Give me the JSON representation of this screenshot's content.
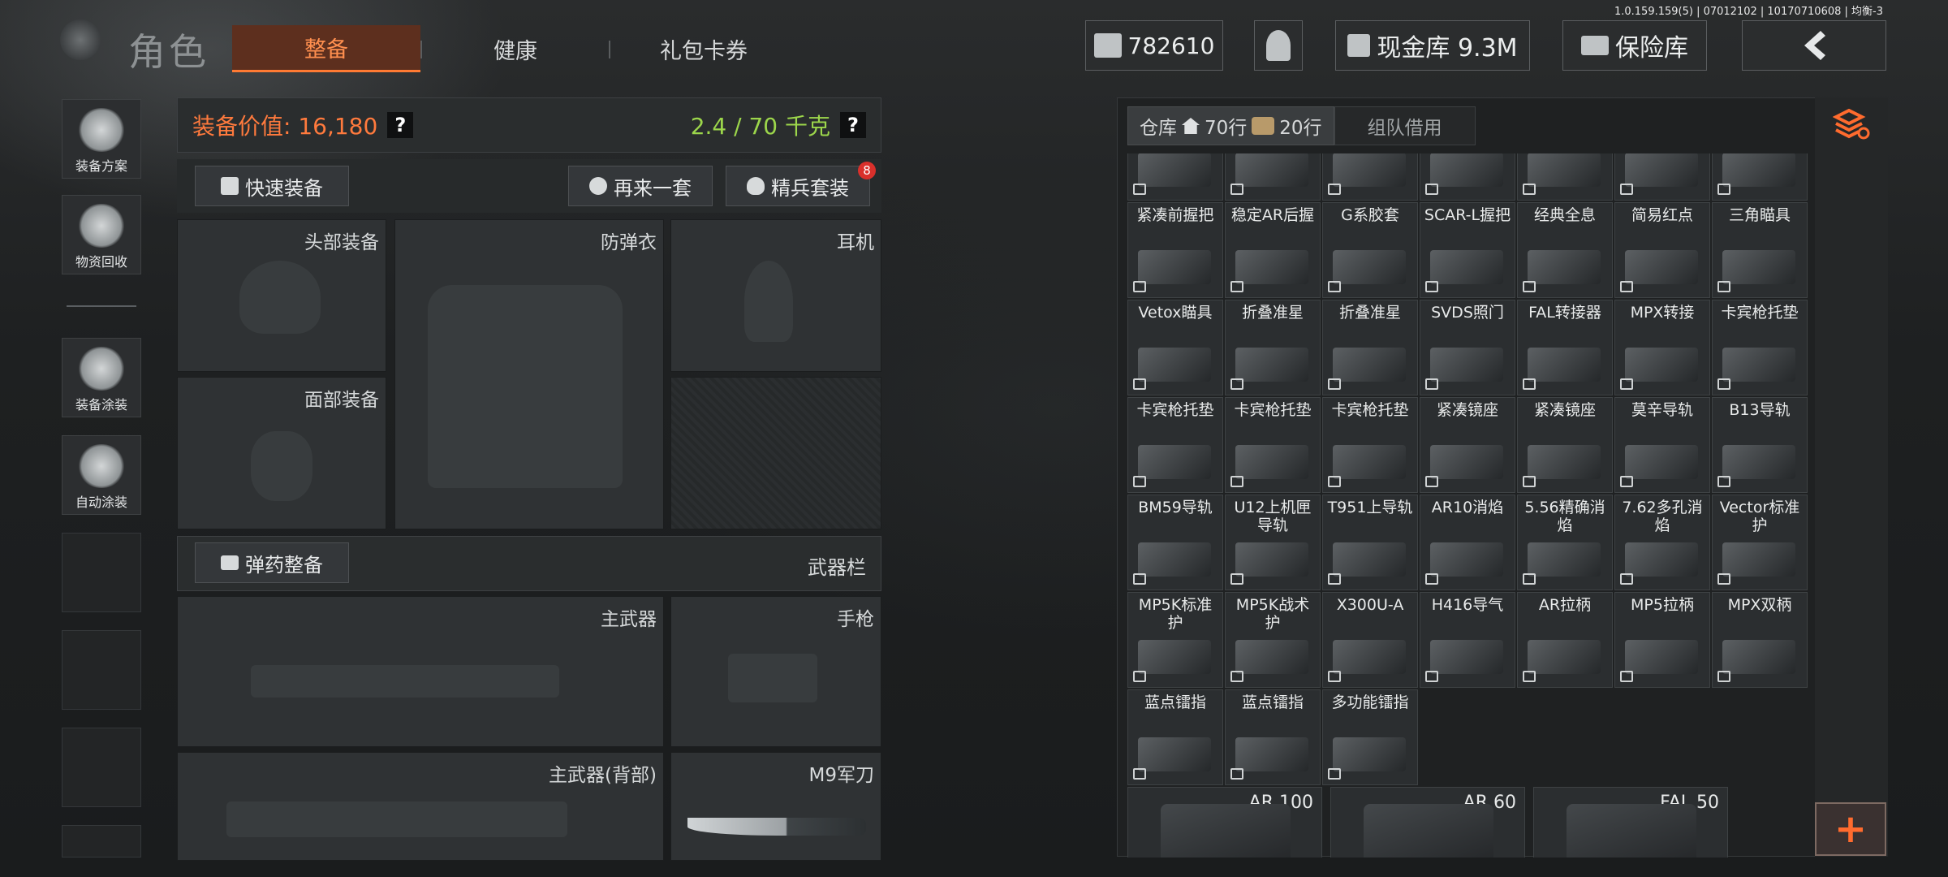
{
  "version": "1.0.159.159(5) | 07012102 | 10170710608 | 均衡-3",
  "header": {
    "title": "角色",
    "tabs": [
      {
        "label": "整备",
        "active": true
      },
      {
        "label": "健康",
        "active": false
      },
      {
        "label": "礼包卡券",
        "active": false
      }
    ],
    "currency": "782610",
    "cash_label": "现金库 9.3M",
    "insurance_label": "保险库"
  },
  "sidebar": [
    {
      "label": "装备方案",
      "icon": "helmet-loadout-icon"
    },
    {
      "label": "物资回收",
      "icon": "recycle-icon"
    },
    {
      "label": "装备涂装",
      "icon": "skin-icon"
    },
    {
      "label": "自动涂装",
      "icon": "auto-paint-icon"
    }
  ],
  "loadout": {
    "value_label": "装备价值: 16,180",
    "weight_label": "2.4 / 70 千克",
    "help": "?",
    "quick_equip": "快速装备",
    "again": "再来一套",
    "elite": "精兵套装",
    "elite_badge": "8",
    "slots": {
      "head": "头部装备",
      "armor": "防弹衣",
      "headset": "耳机",
      "face": "面部装备"
    },
    "ammo_button": "弹药整备",
    "weapon_bar": "武器栏",
    "primary": "主武器",
    "pistol": "手枪",
    "primary_back": "主武器(背部)",
    "knife": "M9军刀"
  },
  "stash": {
    "tab_label": "仓库",
    "rows_a": "70行",
    "rows_b": "20行",
    "team_tab": "组队借用",
    "row0": [
      "",
      "",
      "",
      "",
      "",
      "",
      ""
    ],
    "items": [
      [
        "紧凑前握把",
        "稳定AR后握",
        "G系胶套",
        "SCAR-L握把",
        "经典全息",
        "简易红点",
        "三角瞄具"
      ],
      [
        "Vetox瞄具",
        "折叠准星",
        "折叠准星",
        "SVDS照门",
        "FAL转接器",
        "MPX转接",
        "卡宾枪托垫"
      ],
      [
        "卡宾枪托垫",
        "卡宾枪托垫",
        "卡宾枪托垫",
        "紧凑镜座",
        "紧凑镜座",
        "莫辛导轨",
        "B13导轨"
      ],
      [
        "BM59导轨",
        "U12上机匣导轨",
        "T951上导轨",
        "AR10消焰",
        "5.56精确消焰",
        "7.62多孔消焰",
        "Vector标准护"
      ],
      [
        "MP5K标准护",
        "MP5K战术护",
        "X300U-A",
        "H416导气",
        "AR拉柄",
        "MP5拉柄",
        "MPX双柄"
      ],
      [
        "蓝点镭指",
        "蓝点镭指",
        "多功能镭指"
      ]
    ],
    "mags": [
      "AR 100",
      "AR 60",
      "FAL 50"
    ],
    "add": "+"
  },
  "colors": {
    "accent": "#ff7a3d",
    "weight": "#9cd64b",
    "badge": "#d9302b"
  }
}
